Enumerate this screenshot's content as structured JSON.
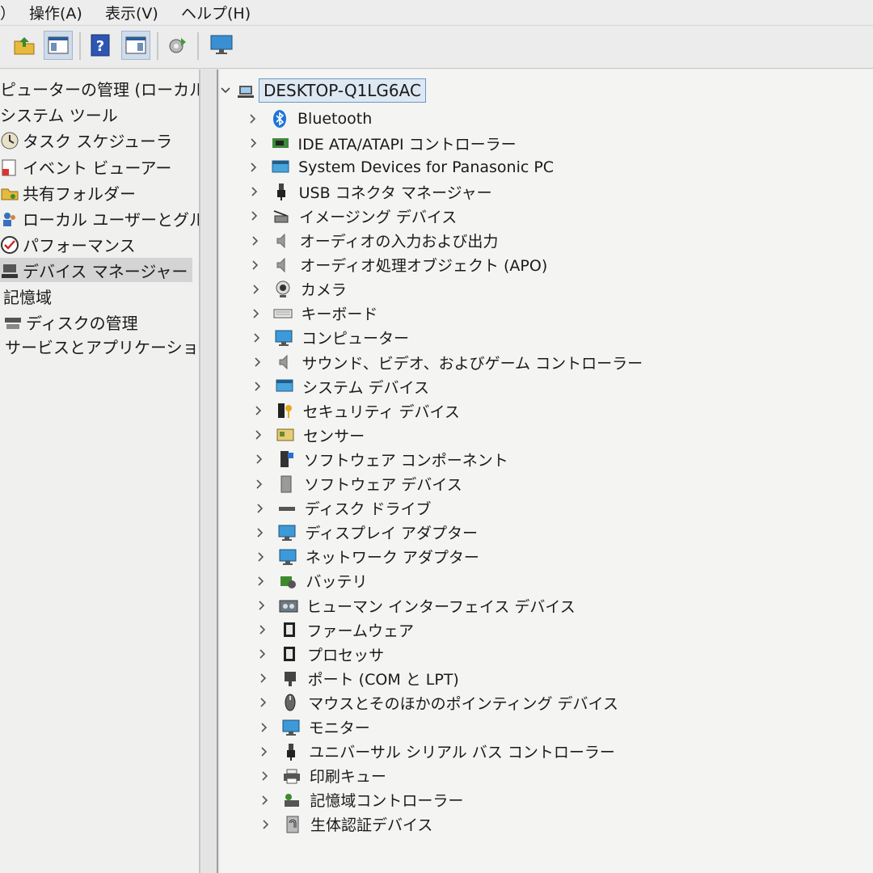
{
  "menu": [
    "）",
    "操作(A)",
    "表示(V)",
    "ヘルプ(H)"
  ],
  "toolbar": [
    "up-folder-icon",
    "show-console-tree-icon",
    "help-icon",
    "action-pane-icon",
    "update-driver-icon",
    "monitor-icon"
  ],
  "left_tree": [
    {
      "label": "ピューターの管理 (ローカル)",
      "icon": ""
    },
    {
      "label": "システム ツール",
      "icon": ""
    },
    {
      "label": "タスク スケジューラ",
      "icon": "clock-icon"
    },
    {
      "label": "イベント ビューアー",
      "icon": "event-viewer-icon"
    },
    {
      "label": "共有フォルダー",
      "icon": "shared-folder-icon"
    },
    {
      "label": "ローカル ユーザーとグループ",
      "icon": "users-icon"
    },
    {
      "label": "パフォーマンス",
      "icon": "performance-icon"
    },
    {
      "label": "デバイス マネージャー",
      "icon": "device-manager-icon",
      "selected": true
    },
    {
      "label": "記憶域",
      "icon": ""
    },
    {
      "label": "ディスクの管理",
      "icon": "disk-management-icon"
    },
    {
      "label": "サービスとアプリケーション",
      "icon": ""
    }
  ],
  "root": {
    "label": "DESKTOP-Q1LG6AC"
  },
  "devices": [
    {
      "label": "Bluetooth",
      "icon": "bluetooth-icon"
    },
    {
      "label": "IDE ATA/ATAPI コントローラー",
      "icon": "ide-controller-icon"
    },
    {
      "label": "System Devices for Panasonic PC",
      "icon": "system-devices-icon"
    },
    {
      "label": "USB コネクタ マネージャー",
      "icon": "usb-connector-icon"
    },
    {
      "label": "イメージング デバイス",
      "icon": "imaging-device-icon"
    },
    {
      "label": "オーディオの入力および出力",
      "icon": "speaker-icon"
    },
    {
      "label": "オーディオ処理オブジェクト (APO)",
      "icon": "speaker-icon"
    },
    {
      "label": "カメラ",
      "icon": "camera-icon"
    },
    {
      "label": "キーボード",
      "icon": "keyboard-icon"
    },
    {
      "label": "コンピューター",
      "icon": "computer-icon"
    },
    {
      "label": "サウンド、ビデオ、およびゲーム コントローラー",
      "icon": "speaker-icon"
    },
    {
      "label": "システム デバイス",
      "icon": "system-folder-icon"
    },
    {
      "label": "セキュリティ デバイス",
      "icon": "security-key-icon"
    },
    {
      "label": "センサー",
      "icon": "sensor-icon"
    },
    {
      "label": "ソフトウェア コンポーネント",
      "icon": "software-component-icon"
    },
    {
      "label": "ソフトウェア デバイス",
      "icon": "software-device-icon"
    },
    {
      "label": "ディスク ドライブ",
      "icon": "disk-drive-icon"
    },
    {
      "label": "ディスプレイ アダプター",
      "icon": "display-adapter-icon"
    },
    {
      "label": "ネットワーク アダプター",
      "icon": "network-adapter-icon"
    },
    {
      "label": "バッテリ",
      "icon": "battery-icon"
    },
    {
      "label": "ヒューマン インターフェイス デバイス",
      "icon": "hid-icon"
    },
    {
      "label": "ファームウェア",
      "icon": "firmware-icon"
    },
    {
      "label": "プロセッサ",
      "icon": "processor-icon"
    },
    {
      "label": "ポート (COM と LPT)",
      "icon": "port-icon"
    },
    {
      "label": "マウスとそのほかのポインティング デバイス",
      "icon": "mouse-icon"
    },
    {
      "label": "モニター",
      "icon": "monitor-icon"
    },
    {
      "label": "ユニバーサル シリアル バス コントローラー",
      "icon": "usb-controller-icon"
    },
    {
      "label": "印刷キュー",
      "icon": "printer-icon"
    },
    {
      "label": "記憶域コントローラー",
      "icon": "storage-controller-icon"
    },
    {
      "label": "生体認証デバイス",
      "icon": "biometric-icon"
    }
  ]
}
